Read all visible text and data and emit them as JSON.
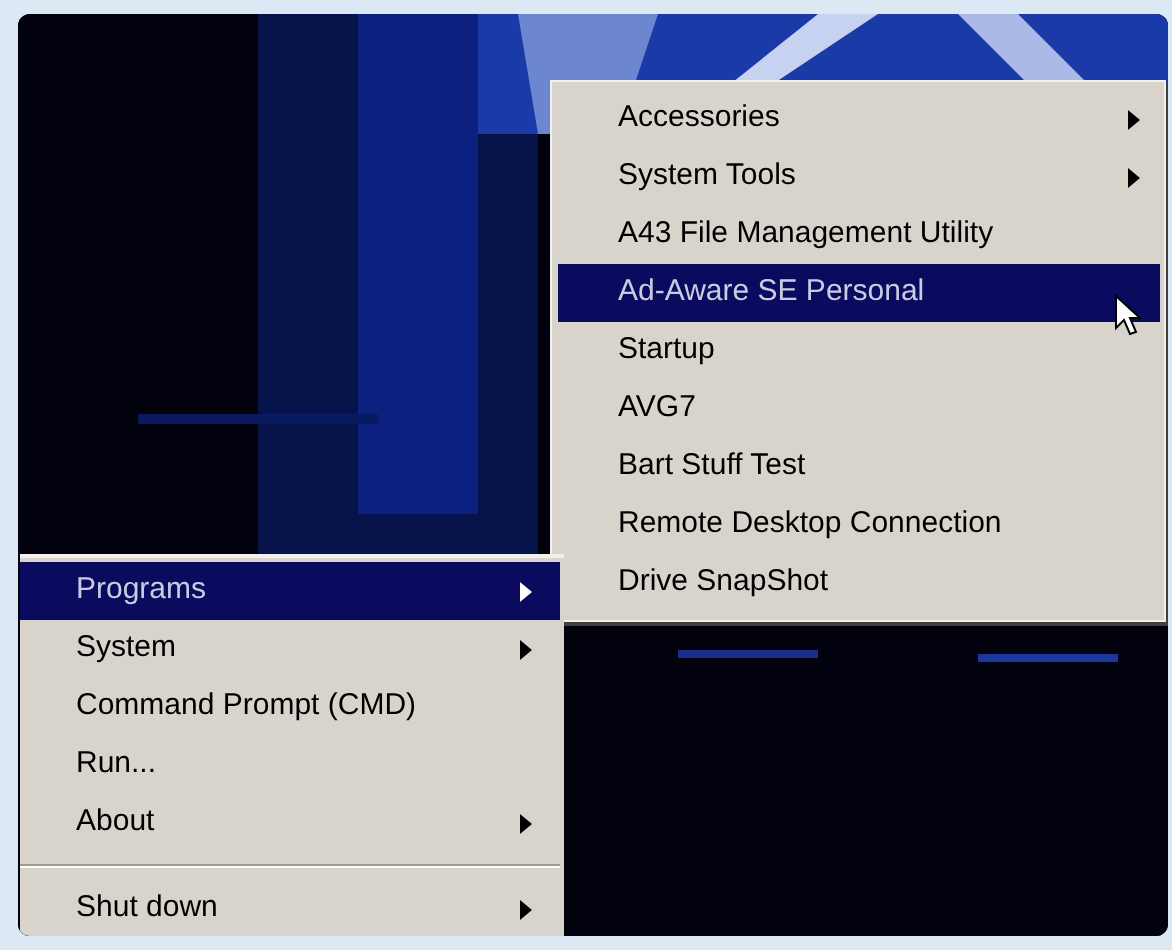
{
  "programs_menu": {
    "items": [
      {
        "label": "Accessories",
        "has_submenu": true,
        "selected": false
      },
      {
        "label": "System Tools",
        "has_submenu": true,
        "selected": false
      },
      {
        "label": "A43 File Management Utility",
        "has_submenu": false,
        "selected": false
      },
      {
        "label": "Ad-Aware SE Personal",
        "has_submenu": false,
        "selected": true
      },
      {
        "label": "Startup",
        "has_submenu": false,
        "selected": false
      },
      {
        "label": "AVG7",
        "has_submenu": false,
        "selected": false
      },
      {
        "label": "Bart Stuff Test",
        "has_submenu": false,
        "selected": false
      },
      {
        "label": "Remote Desktop Connection",
        "has_submenu": false,
        "selected": false
      },
      {
        "label": "Drive SnapShot",
        "has_submenu": false,
        "selected": false
      }
    ]
  },
  "start_menu": {
    "items": [
      {
        "kind": "item",
        "label": "Programs",
        "has_submenu": true,
        "selected": true
      },
      {
        "kind": "item",
        "label": "System",
        "has_submenu": true,
        "selected": false
      },
      {
        "kind": "item",
        "label": "Command Prompt (CMD)",
        "has_submenu": false,
        "selected": false
      },
      {
        "kind": "item",
        "label": "Run...",
        "has_submenu": false,
        "selected": false
      },
      {
        "kind": "item",
        "label": "About",
        "has_submenu": true,
        "selected": false
      },
      {
        "kind": "separator"
      },
      {
        "kind": "item",
        "label": "Shut down",
        "has_submenu": true,
        "selected": false
      }
    ]
  }
}
